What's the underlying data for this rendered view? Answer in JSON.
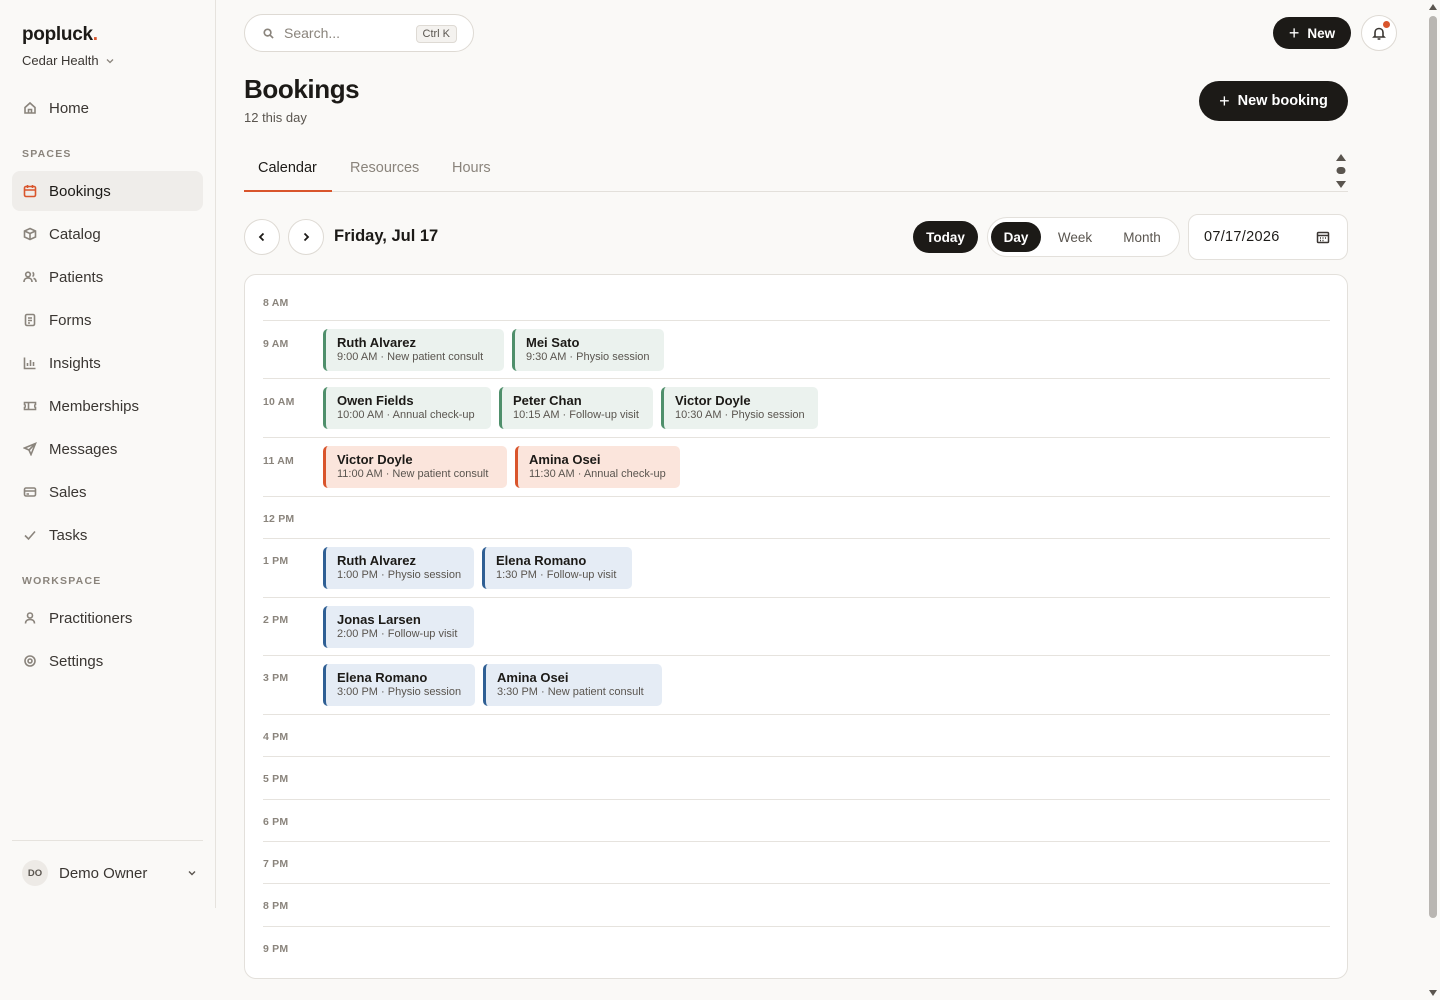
{
  "brand": {
    "name": "popluck",
    "dot": "."
  },
  "org": {
    "name": "Cedar Health"
  },
  "nav": {
    "home": "Home",
    "spaces_label": "SPACES",
    "spaces": [
      "Bookings",
      "Catalog",
      "Patients",
      "Forms",
      "Insights",
      "Memberships",
      "Messages",
      "Sales",
      "Tasks"
    ],
    "workspace_label": "WORKSPACE",
    "workspace": [
      "Practitioners",
      "Settings"
    ],
    "active": "Bookings"
  },
  "user": {
    "initials": "DO",
    "name": "Demo Owner"
  },
  "search": {
    "placeholder": "Search...",
    "shortcut": "Ctrl K"
  },
  "topbar": {
    "new_label": "New"
  },
  "page": {
    "title": "Bookings",
    "subtitle": "12 this day",
    "new_booking_label": "New booking"
  },
  "tabs": [
    "Calendar",
    "Resources",
    "Hours"
  ],
  "toolbar": {
    "date_title": "Friday, Jul 17",
    "today_label": "Today",
    "views": [
      "Day",
      "Week",
      "Month"
    ],
    "active_view": "Day",
    "date_value": "07/17/2026"
  },
  "calendar": {
    "hours": [
      "8 AM",
      "9 AM",
      "10 AM",
      "11 AM",
      "12 PM",
      "1 PM",
      "2 PM",
      "3 PM",
      "4 PM",
      "5 PM",
      "6 PM",
      "7 PM",
      "8 PM",
      "9 PM"
    ],
    "colors": {
      "green": "#4f8f6b",
      "red": "#d9552c",
      "blue": "#2f5f94"
    },
    "rows": [
      {
        "hour": "9 AM",
        "events": [
          {
            "name": "Ruth Alvarez",
            "detail": "9:00 AM · New patient consult",
            "color": "green"
          },
          {
            "name": "Mei Sato",
            "detail": "9:30 AM · Physio session",
            "color": "green"
          }
        ]
      },
      {
        "hour": "10 AM",
        "events": [
          {
            "name": "Owen Fields",
            "detail": "10:00 AM · Annual check-up",
            "color": "green"
          },
          {
            "name": "Peter Chan",
            "detail": "10:15 AM · Follow-up visit",
            "color": "green"
          },
          {
            "name": "Victor Doyle",
            "detail": "10:30 AM · Physio session",
            "color": "green"
          }
        ]
      },
      {
        "hour": "11 AM",
        "events": [
          {
            "name": "Victor Doyle",
            "detail": "11:00 AM · New patient consult",
            "color": "red"
          },
          {
            "name": "Amina Osei",
            "detail": "11:30 AM · Annual check-up",
            "color": "red"
          }
        ]
      },
      {
        "hour": "1 PM",
        "events": [
          {
            "name": "Ruth Alvarez",
            "detail": "1:00 PM · Physio session",
            "color": "blue"
          },
          {
            "name": "Elena Romano",
            "detail": "1:30 PM · Follow-up visit",
            "color": "blue"
          }
        ]
      },
      {
        "hour": "2 PM",
        "events": [
          {
            "name": "Jonas Larsen",
            "detail": "2:00 PM · Follow-up visit",
            "color": "blue"
          }
        ]
      },
      {
        "hour": "3 PM",
        "events": [
          {
            "name": "Elena Romano",
            "detail": "3:00 PM · Physio session",
            "color": "blue"
          },
          {
            "name": "Amina Osei",
            "detail": "3:30 PM · New patient consult",
            "color": "blue"
          }
        ]
      }
    ]
  }
}
